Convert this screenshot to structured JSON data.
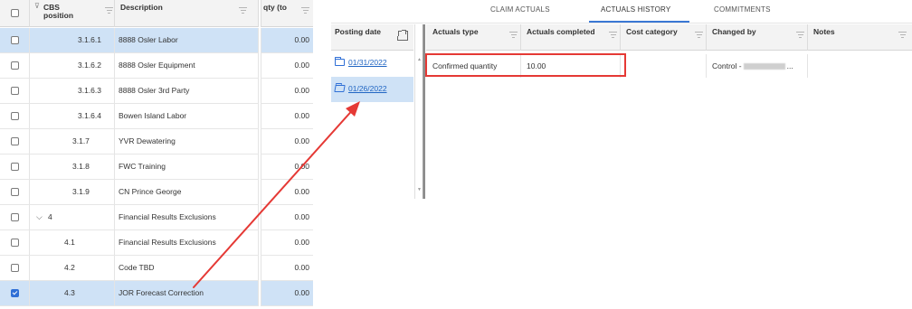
{
  "left_grid": {
    "headers": {
      "cbs": "CBS\nposition",
      "description": "Description"
    },
    "rows": [
      {
        "cbs": "3.1.6.1",
        "description": "8888 Osler Labor",
        "checked": false,
        "selected": true,
        "indent": 3
      },
      {
        "cbs": "3.1.6.2",
        "description": "8888 Osler Equipment",
        "checked": false,
        "selected": false,
        "indent": 3
      },
      {
        "cbs": "3.1.6.3",
        "description": "8888 Osler 3rd Party",
        "checked": false,
        "selected": false,
        "indent": 3
      },
      {
        "cbs": "3.1.6.4",
        "description": "Bowen Island Labor",
        "checked": false,
        "selected": false,
        "indent": 3
      },
      {
        "cbs": "3.1.7",
        "description": "YVR Dewatering",
        "checked": false,
        "selected": false,
        "indent": 2
      },
      {
        "cbs": "3.1.8",
        "description": "FWC Training",
        "checked": false,
        "selected": false,
        "indent": 2
      },
      {
        "cbs": "3.1.9",
        "description": "CN Prince George",
        "checked": false,
        "selected": false,
        "indent": 2
      },
      {
        "cbs": "4",
        "description": "Financial Results Exclusions",
        "checked": false,
        "selected": false,
        "indent": 0,
        "expanded": true
      },
      {
        "cbs": "4.1",
        "description": "Financial Results Exclusions",
        "checked": false,
        "selected": false,
        "indent": 1
      },
      {
        "cbs": "4.2",
        "description": "Code TBD",
        "checked": false,
        "selected": false,
        "indent": 1
      },
      {
        "cbs": "4.3",
        "description": "JOR Forecast Correction",
        "checked": true,
        "selected": true,
        "indent": 1
      }
    ]
  },
  "qty_column": {
    "header": "qty (to",
    "values": [
      "0.00",
      "0.00",
      "0.00",
      "0.00",
      "0.00",
      "0.00",
      "0.00",
      "0.00",
      "0.00",
      "0.00",
      "0.00"
    ]
  },
  "tabs": [
    {
      "label": "CLAIM ACTUALS",
      "active": false
    },
    {
      "label": "ACTUALS HISTORY",
      "active": true
    },
    {
      "label": "COMMITMENTS",
      "active": false
    }
  ],
  "posting_panel": {
    "header": "Posting date",
    "dates": [
      {
        "date": "01/31/2022",
        "selected": false,
        "icon": "folder-icon"
      },
      {
        "date": "01/26/2022",
        "selected": true,
        "icon": "folder-open-icon"
      }
    ]
  },
  "actuals_grid": {
    "headers": {
      "actuals_type": "Actuals type",
      "actuals_completed": "Actuals completed",
      "cost_category": "Cost category",
      "changed_by": "Changed by",
      "notes": "Notes"
    },
    "rows": [
      {
        "actuals_type": "Confirmed quantity",
        "actuals_completed": "10.00",
        "cost_category": "",
        "changed_by": "Control -",
        "changed_by_suffix": "...",
        "notes": ""
      }
    ]
  },
  "colors": {
    "selection": "#cfe2f6",
    "accent": "#3a78d4",
    "link": "#2166c3",
    "highlight_box": "#e53935",
    "arrow": "#e53935"
  }
}
